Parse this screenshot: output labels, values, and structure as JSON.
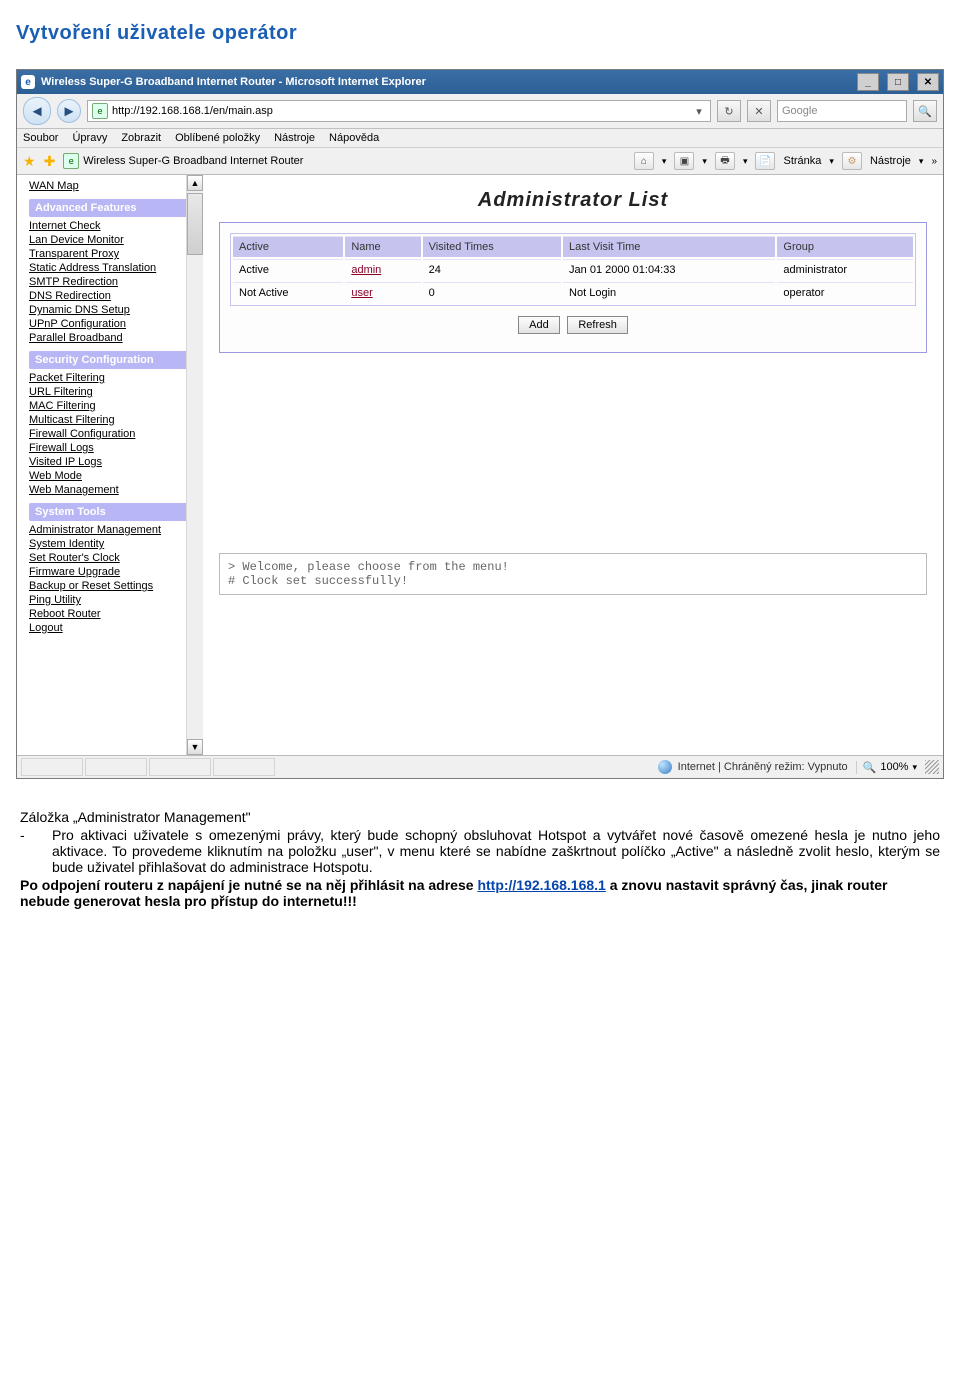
{
  "doc": {
    "heading": "Vytvoření uživatele operátor",
    "tab_label": "Záložka „Administrator Management\"",
    "dash": "-",
    "paragraph": "Pro aktivaci uživatele s omezenými právy, který bude schopný obsluhovat Hotspot a vytvářet nové časově omezené hesla je nutno jeho aktivace. To provedeme kliknutím na položku „user\", v menu které se nabídne zaškrtnout políčko „Active\" a následně zvolit heslo, kterým se bude uživatel přihlašovat do administrace Hotspotu.",
    "note1": "Po odpojení routeru z napájení je nutné se na něj přihlásit na adrese ",
    "note_link": "http://192.168.168.1",
    "note2": " a znovu nastavit správný čas, jinak router nebude generovat hesla pro přístup do internetu!!!"
  },
  "browser": {
    "title": "Wireless Super-G Broadband Internet Router - Microsoft Internet Explorer",
    "url": "http://192.168.168.1/en/main.asp",
    "search_placeholder": "Google",
    "menus": [
      "Soubor",
      "Úpravy",
      "Zobrazit",
      "Oblíbené položky",
      "Nástroje",
      "Nápověda"
    ],
    "tab": "Wireless Super-G Broadband Internet Router",
    "toolbar": {
      "page": "Stránka",
      "tools": "Nástroje"
    },
    "status": "Internet | Chráněný režim: Vypnuto",
    "zoom": "100%"
  },
  "sidebar": {
    "top": [
      "WAN Map"
    ],
    "sections": [
      {
        "title": "Advanced Features",
        "items": [
          "Internet Check",
          "Lan Device Monitor",
          "Transparent Proxy",
          "Static Address Translation",
          "SMTP Redirection",
          "DNS Redirection",
          "Dynamic DNS Setup",
          "UPnP Configuration",
          "Parallel Broadband"
        ]
      },
      {
        "title": "Security Configuration",
        "items": [
          "Packet Filtering",
          "URL Filtering",
          "MAC Filtering",
          "Multicast Filtering",
          "Firewall Configuration",
          "Firewall Logs",
          "Visited IP Logs",
          "Web Mode",
          "Web Management"
        ]
      },
      {
        "title": "System Tools",
        "items": [
          "Administrator Management",
          "System Identity",
          "Set Router's Clock",
          "Firmware Upgrade",
          "Backup or Reset Settings",
          "Ping Utility",
          "Reboot Router",
          "Logout"
        ]
      }
    ]
  },
  "main": {
    "title": "Administrator List",
    "headers": [
      "Active",
      "Name",
      "Visited Times",
      "Last Visit Time",
      "Group"
    ],
    "rows": [
      [
        "Active",
        "admin",
        "24",
        "Jan 01 2000 01:04:33",
        "administrator"
      ],
      [
        "Not Active",
        "user",
        "0",
        "Not Login",
        "operator"
      ]
    ],
    "buttons": {
      "add": "Add",
      "refresh": "Refresh"
    },
    "console1": "> Welcome, please choose from the menu!",
    "console2": "# Clock set successfully!"
  }
}
